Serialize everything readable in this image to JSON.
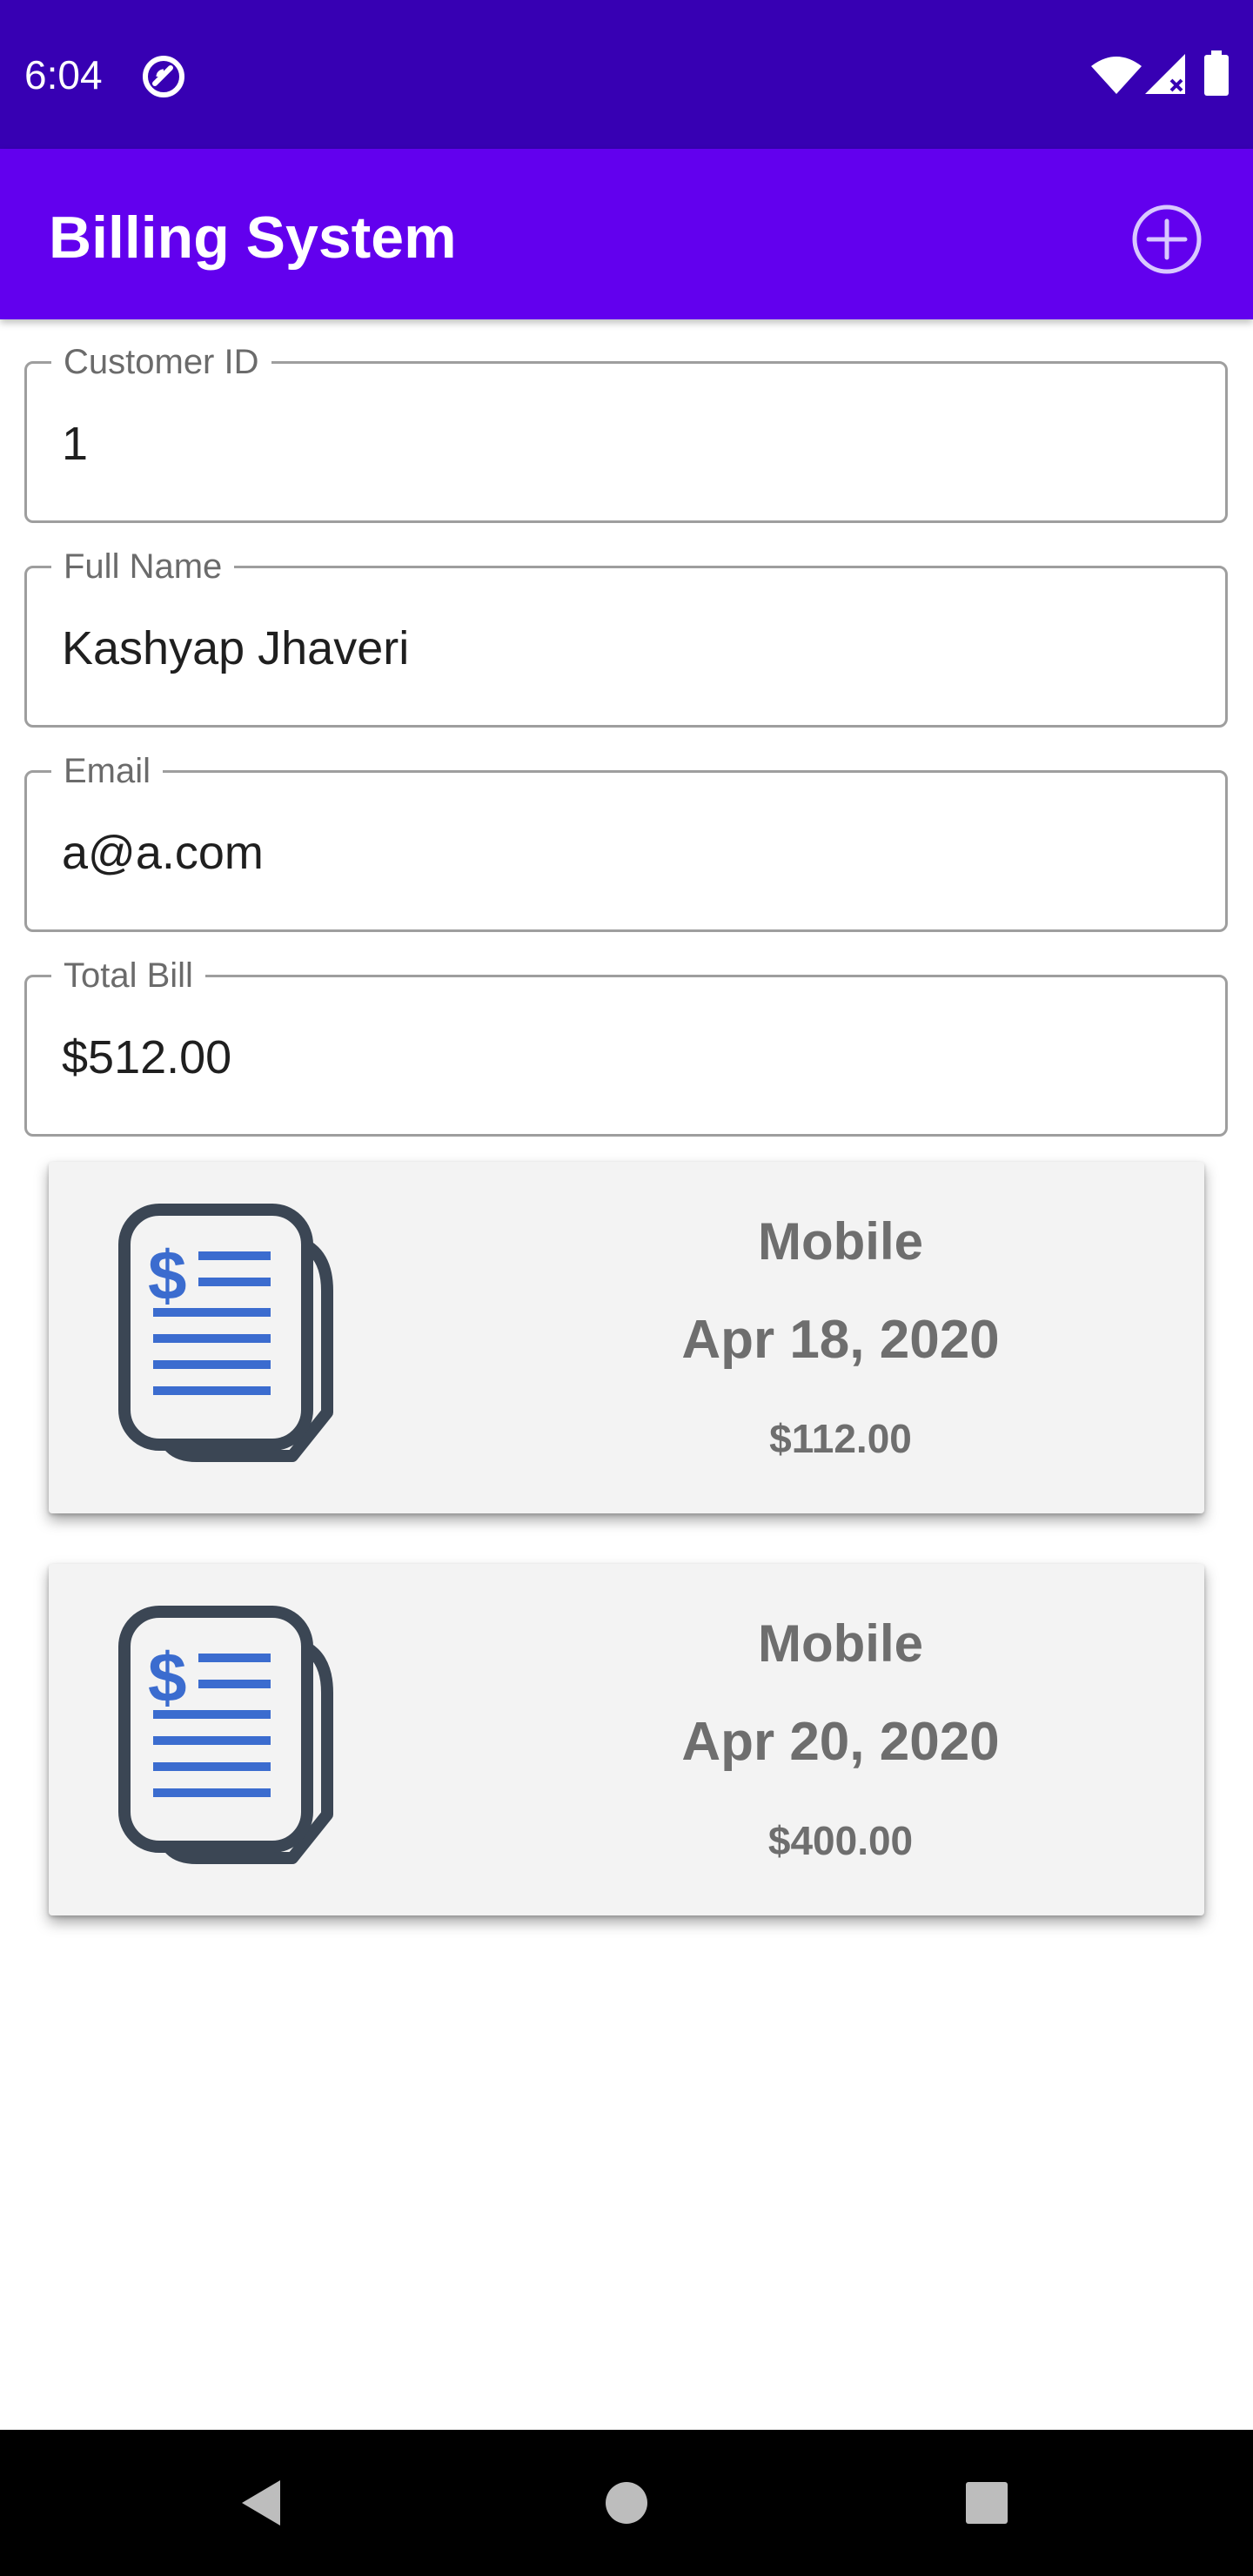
{
  "status_bar": {
    "time": "6:04",
    "icons": [
      "sync-icon",
      "wifi-icon",
      "cell-signal-icon",
      "battery-icon"
    ]
  },
  "app_bar": {
    "title": "Billing System",
    "add_icon": "add-circle-icon"
  },
  "form": {
    "customer_id": {
      "label": "Customer ID",
      "value": "1"
    },
    "full_name": {
      "label": "Full Name",
      "value": "Kashyap Jhaveri"
    },
    "email": {
      "label": "Email",
      "value": "a@a.com"
    },
    "total_bill": {
      "label": "Total Bill",
      "value": "$512.00"
    }
  },
  "bills": [
    {
      "type": "Mobile",
      "date": "Apr 18, 2020",
      "amount": "$112.00",
      "icon": "invoice-document-icon"
    },
    {
      "type": "Mobile",
      "date": "Apr 20, 2020",
      "amount": "$400.00",
      "icon": "invoice-document-icon"
    }
  ],
  "nav_bar": {
    "buttons": [
      "back-icon",
      "home-icon",
      "recents-icon"
    ]
  },
  "colors": {
    "status_bar": "#3700b3",
    "app_bar": "#6200ee",
    "icon_dark": "#3b4654",
    "icon_blue": "#3b6ccf",
    "card_bg": "#f3f3f3",
    "card_text": "#6e6e6e"
  }
}
